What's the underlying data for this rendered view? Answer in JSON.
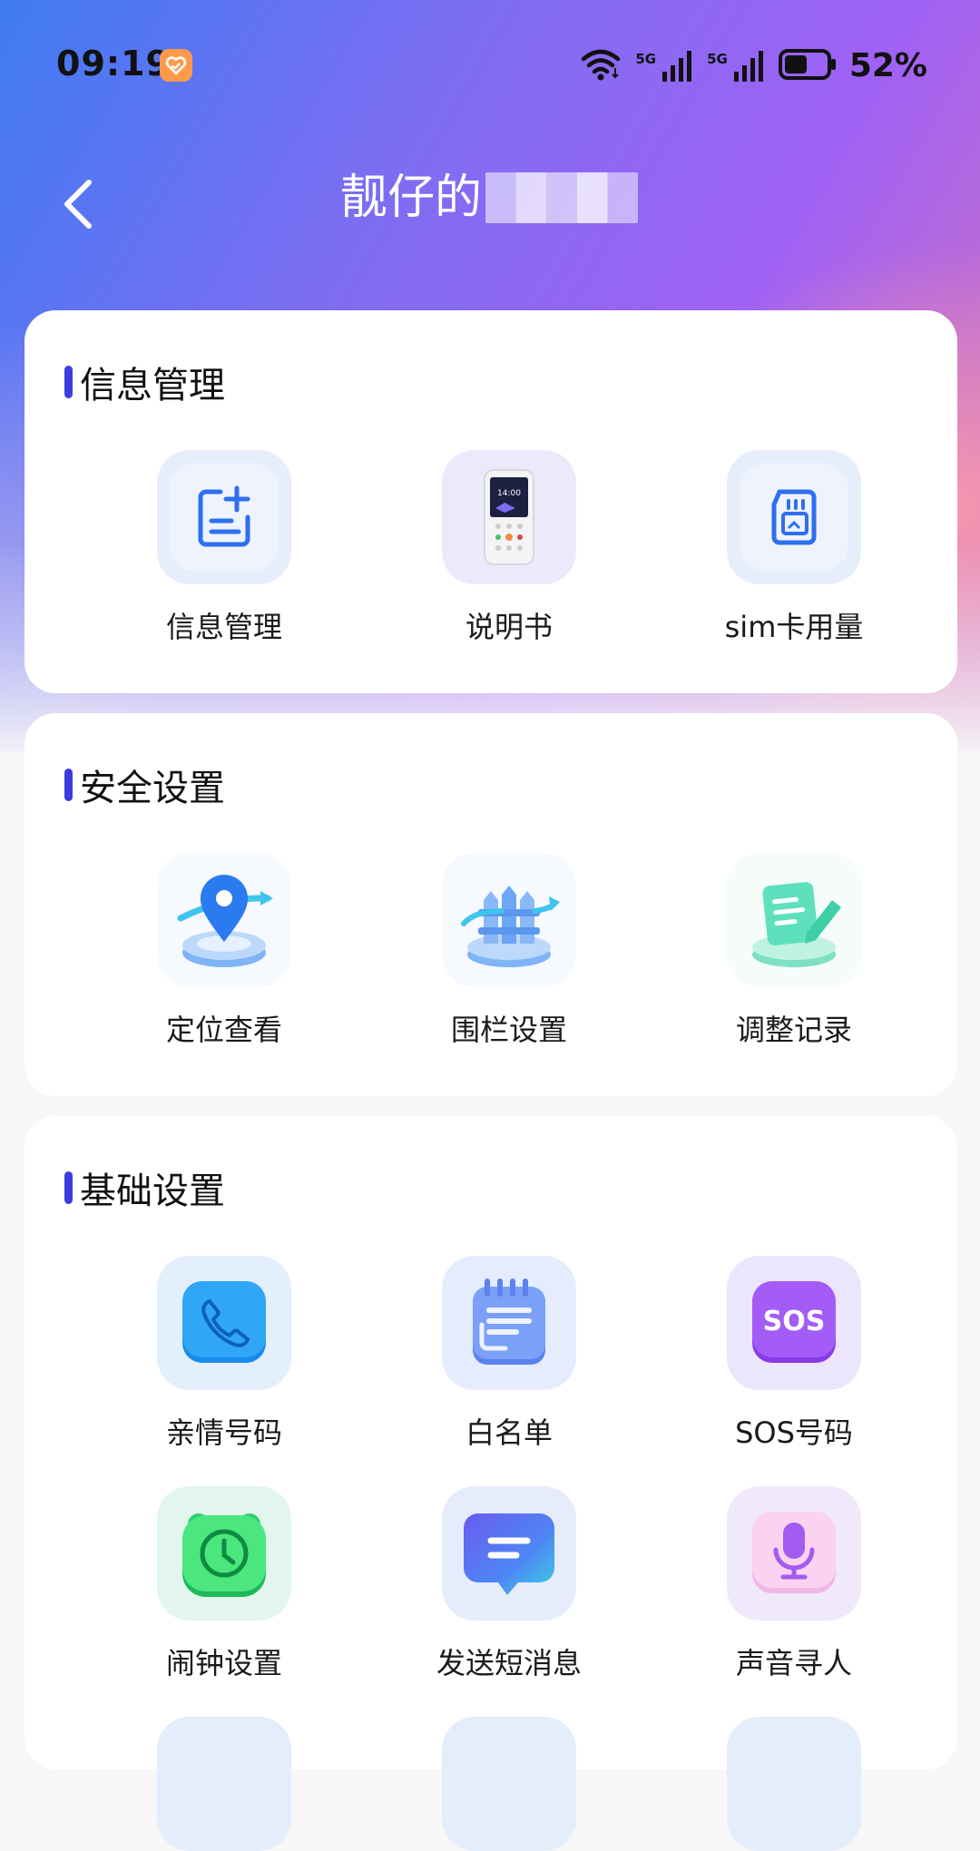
{
  "status_bar": {
    "time": "09:19",
    "network1": "5G",
    "network2": "5G",
    "battery": "52%",
    "battery_level": 0.52
  },
  "header": {
    "title": "靓仔的"
  },
  "sections": [
    {
      "title": "信息管理",
      "items": [
        {
          "label": "信息管理",
          "icon": "document-add-icon"
        },
        {
          "label": "说明书",
          "icon": "phone-device-icon"
        },
        {
          "label": "sim卡用量",
          "icon": "sim-card-icon"
        }
      ]
    },
    {
      "title": "安全设置",
      "items": [
        {
          "label": "定位查看",
          "icon": "location-pin-icon"
        },
        {
          "label": "围栏设置",
          "icon": "fence-icon"
        },
        {
          "label": "调整记录",
          "icon": "edit-record-icon"
        }
      ]
    },
    {
      "title": "基础设置",
      "items": [
        {
          "label": "亲情号码",
          "icon": "phone-icon"
        },
        {
          "label": "白名单",
          "icon": "notepad-icon"
        },
        {
          "label": "SOS号码",
          "icon": "sos-icon",
          "badge": "SOS"
        },
        {
          "label": "闹钟设置",
          "icon": "alarm-clock-icon"
        },
        {
          "label": "发送短消息",
          "icon": "message-icon"
        },
        {
          "label": "声音寻人",
          "icon": "microphone-icon"
        }
      ]
    }
  ],
  "device_screen_time": "14:00"
}
